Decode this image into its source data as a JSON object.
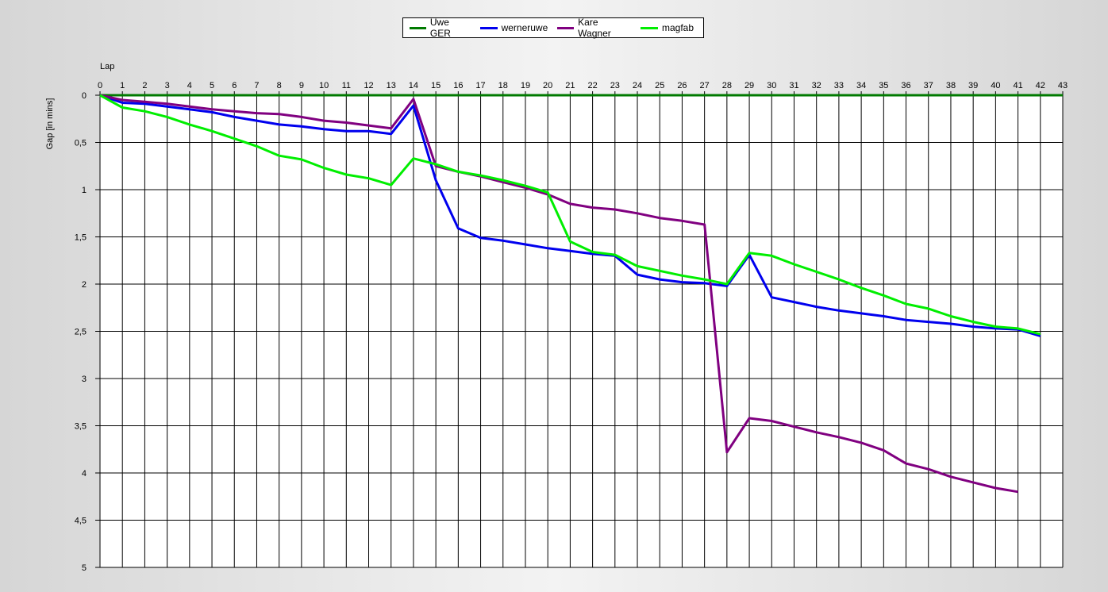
{
  "chart_data": {
    "type": "line",
    "xlabel": "Lap",
    "ylabel": "Gap [in mins]",
    "xlim": [
      0,
      43
    ],
    "ylim": [
      0,
      5
    ],
    "y_inverted": true,
    "x_ticks": [
      0,
      1,
      2,
      3,
      4,
      5,
      6,
      7,
      8,
      9,
      10,
      11,
      12,
      13,
      14,
      15,
      16,
      17,
      18,
      19,
      20,
      21,
      22,
      23,
      24,
      25,
      26,
      27,
      28,
      29,
      30,
      31,
      32,
      33,
      34,
      35,
      36,
      37,
      38,
      39,
      40,
      41,
      42,
      43
    ],
    "y_ticks": [
      "0",
      "0,5",
      "1",
      "1,5",
      "2",
      "2,5",
      "3",
      "3,5",
      "4",
      "4,5",
      "5"
    ],
    "y_tick_values": [
      0,
      0.5,
      1,
      1.5,
      2,
      2.5,
      3,
      3.5,
      4,
      4.5,
      5
    ],
    "grid": true,
    "legend_position": "top-center",
    "series": [
      {
        "name": "Uwe GER",
        "color": "#007a00",
        "x": [
          0,
          1,
          2,
          3,
          4,
          5,
          6,
          7,
          8,
          9,
          10,
          11,
          12,
          13,
          14,
          15,
          16,
          17,
          18,
          19,
          20,
          21,
          22,
          23,
          24,
          25,
          26,
          27,
          28,
          29,
          30,
          31,
          32,
          33,
          34,
          35,
          36,
          37,
          38,
          39,
          40,
          41,
          42,
          43
        ],
        "y": [
          0,
          0,
          0,
          0,
          0,
          0,
          0,
          0,
          0,
          0,
          0,
          0,
          0,
          0,
          0,
          0,
          0,
          0,
          0,
          0,
          0,
          0,
          0,
          0,
          0,
          0,
          0,
          0,
          0,
          0,
          0,
          0,
          0,
          0,
          0,
          0,
          0,
          0,
          0,
          0,
          0,
          0,
          0,
          0
        ]
      },
      {
        "name": "werneruwe",
        "color": "#0000ee",
        "x": [
          0,
          1,
          2,
          3,
          4,
          5,
          6,
          7,
          8,
          9,
          10,
          11,
          12,
          13,
          14,
          15,
          16,
          17,
          18,
          19,
          20,
          21,
          22,
          23,
          24,
          25,
          26,
          27,
          28,
          29,
          30,
          31,
          32,
          33,
          34,
          35,
          36,
          37,
          38,
          39,
          40,
          41,
          42
        ],
        "y": [
          0,
          0.08,
          0.09,
          0.12,
          0.15,
          0.18,
          0.23,
          0.27,
          0.31,
          0.33,
          0.36,
          0.38,
          0.38,
          0.41,
          0.11,
          0.9,
          1.41,
          1.51,
          1.54,
          1.58,
          1.62,
          1.65,
          1.68,
          1.7,
          1.9,
          1.95,
          1.98,
          1.99,
          2.02,
          1.69,
          2.14,
          2.19,
          2.24,
          2.28,
          2.31,
          2.34,
          2.38,
          2.4,
          2.42,
          2.45,
          2.47,
          2.48,
          2.55
        ]
      },
      {
        "name": "Kare Wagner",
        "color": "#800080",
        "x": [
          0,
          1,
          2,
          3,
          4,
          5,
          6,
          7,
          8,
          9,
          10,
          11,
          12,
          13,
          14,
          15,
          16,
          17,
          18,
          19,
          20,
          21,
          22,
          23,
          24,
          25,
          26,
          27,
          28,
          29,
          30,
          31,
          32,
          33,
          34,
          35,
          36,
          37,
          38,
          39,
          40,
          41
        ],
        "y": [
          0,
          0.05,
          0.07,
          0.09,
          0.12,
          0.15,
          0.17,
          0.19,
          0.2,
          0.23,
          0.27,
          0.29,
          0.32,
          0.35,
          0.04,
          0.75,
          0.81,
          0.86,
          0.92,
          0.98,
          1.05,
          1.15,
          1.19,
          1.21,
          1.25,
          1.3,
          1.33,
          1.37,
          3.78,
          3.42,
          3.45,
          3.51,
          3.57,
          3.62,
          3.68,
          3.76,
          3.9,
          3.96,
          4.04,
          4.1,
          4.16,
          4.2
        ]
      },
      {
        "name": "magfab",
        "color": "#00ee00",
        "x": [
          0,
          1,
          2,
          3,
          4,
          5,
          6,
          7,
          8,
          9,
          10,
          11,
          12,
          13,
          14,
          15,
          16,
          17,
          18,
          19,
          20,
          21,
          22,
          23,
          24,
          25,
          26,
          27,
          28,
          29,
          30,
          31,
          32,
          33,
          34,
          35,
          36,
          37,
          38,
          39,
          40,
          41,
          42
        ],
        "y": [
          0,
          0.13,
          0.17,
          0.23,
          0.31,
          0.38,
          0.46,
          0.54,
          0.64,
          0.68,
          0.77,
          0.84,
          0.88,
          0.95,
          0.67,
          0.73,
          0.81,
          0.85,
          0.9,
          0.96,
          1.03,
          1.55,
          1.66,
          1.69,
          1.81,
          1.86,
          1.91,
          1.95,
          2.0,
          1.67,
          1.7,
          1.79,
          1.87,
          1.95,
          2.04,
          2.12,
          2.21,
          2.26,
          2.34,
          2.4,
          2.45,
          2.47,
          2.53
        ]
      }
    ]
  }
}
